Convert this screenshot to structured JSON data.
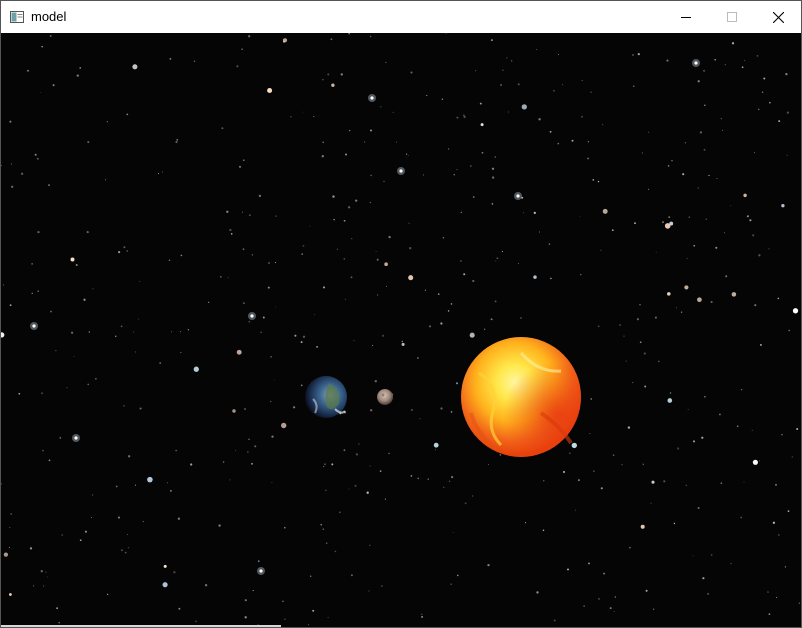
{
  "window": {
    "title": "model",
    "icon": "app-window-icon",
    "controls": {
      "minimize_icon": "minimize-icon",
      "maximize_icon": "maximize-icon",
      "close_icon": "close-icon"
    }
  },
  "scene": {
    "background": "starfield",
    "bodies": [
      {
        "name": "sun",
        "texture": "fiery-orange-yellow"
      },
      {
        "name": "earth",
        "texture": "blue-green-planet"
      },
      {
        "name": "moon",
        "texture": "grey-rock"
      }
    ]
  },
  "colors": {
    "titlebar_bg": "#ffffff",
    "space_bg": "#050505",
    "sun_core": "#ffe84a",
    "sun_edge": "#e8420c",
    "earth": "#2c4a7a",
    "moon": "#a08a80"
  }
}
